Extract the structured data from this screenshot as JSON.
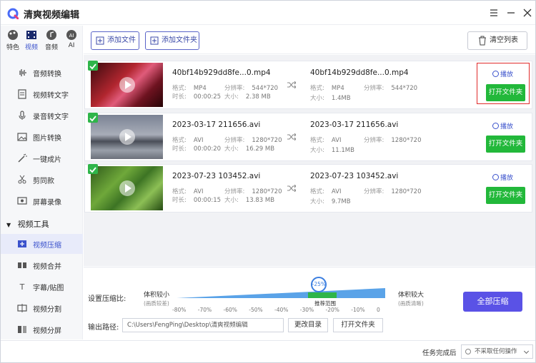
{
  "app": {
    "title": "清爽视频编辑"
  },
  "sidebar": {
    "categories": [
      {
        "label": "特色"
      },
      {
        "label": "视频"
      },
      {
        "label": "音频"
      },
      {
        "label": "AI"
      }
    ],
    "items": [
      {
        "label": "音频转换"
      },
      {
        "label": "视频转文字"
      },
      {
        "label": "录音转文字"
      },
      {
        "label": "图片转换"
      },
      {
        "label": "一键成片"
      },
      {
        "label": "剪同款"
      },
      {
        "label": "屏幕录像"
      }
    ],
    "section_title": "视频工具",
    "tools": [
      {
        "label": "视频压缩"
      },
      {
        "label": "视频合并"
      },
      {
        "label": "字幕/贴图"
      },
      {
        "label": "视频分割"
      },
      {
        "label": "视频分屏"
      }
    ]
  },
  "toolbar": {
    "add_file": "添加文件",
    "add_folder": "添加文件夹",
    "clear_list": "清空列表"
  },
  "files": [
    {
      "src": {
        "name": "40bf14b929dd8fe...0.mp4",
        "format_label": "格式:",
        "format": "MP4",
        "res_label": "分辨率:",
        "res": "544*720",
        "dur_label": "时长:",
        "duration": "00:00:25",
        "size_label": "大小:",
        "size": "2.38 MB"
      },
      "out": {
        "name": "40bf14b929dd8fe...0.mp4",
        "format_label": "格式:",
        "format": "MP4",
        "res_label": "分辨率:",
        "res": "544*720",
        "size_label": "大小:",
        "size": "1.4MB"
      },
      "play": "播放",
      "open": "打开文件夹"
    },
    {
      "src": {
        "name": "2023-03-17 211656.avi",
        "format_label": "格式:",
        "format": "AVI",
        "res_label": "分辨率:",
        "res": "1280*720",
        "dur_label": "时长:",
        "duration": "00:00:20",
        "size_label": "大小:",
        "size": "16.29 MB"
      },
      "out": {
        "name": "2023-03-17 211656.avi",
        "format_label": "格式:",
        "format": "AVI",
        "res_label": "分辨率:",
        "res": "1280*720",
        "size_label": "大小:",
        "size": "11.1MB"
      },
      "play": "播放",
      "open": "打开文件夹"
    },
    {
      "src": {
        "name": "2023-07-23 103452.avi",
        "format_label": "格式:",
        "format": "AVI",
        "res_label": "分辨率:",
        "res": "1280*720",
        "dur_label": "时长:",
        "duration": "00:00:15",
        "size_label": "大小:",
        "size": "13.83 MB"
      },
      "out": {
        "name": "2023-07-23 103452.avi",
        "format_label": "格式:",
        "format": "AVI",
        "res_label": "分辨率:",
        "res": "1280*720",
        "size_label": "大小:",
        "size": "9.7MB"
      },
      "play": "播放",
      "open": "打开文件夹"
    }
  ],
  "compress": {
    "label": "设置压缩比:",
    "left_title": "体积较小",
    "left_sub": "(画质较差)",
    "right_title": "体积较大",
    "right_sub": "(画质清晰)",
    "marker": "-25%",
    "recommended": "推荐范围",
    "ticks": [
      "-80%",
      "-70%",
      "-60%",
      "-50%",
      "-40%",
      "-30%",
      "-20%",
      "-10%",
      "0"
    ],
    "value_percent": -25
  },
  "output": {
    "label": "输出路径:",
    "path": "C:\\Users\\FengPing\\Desktop\\清爽视频编辑",
    "change_dir": "更改目录",
    "open_folder": "打开文件夹"
  },
  "actions": {
    "compress_all": "全部压缩"
  },
  "status": {
    "after_task_label": "任务完成后",
    "after_task_value": "不采取任何操作"
  },
  "colors": {
    "accent": "#5a52e6",
    "green": "#22b83a",
    "highlight": "#e02b2b"
  }
}
